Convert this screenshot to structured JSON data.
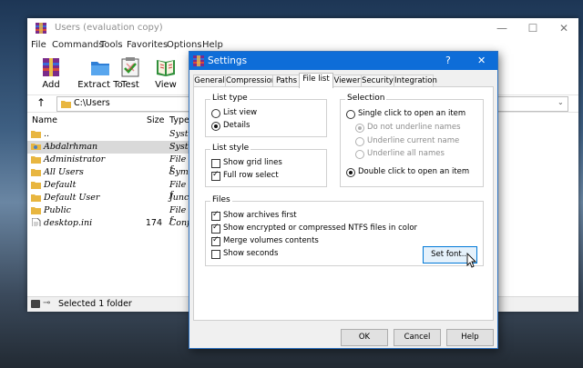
{
  "main_window": {
    "title": "Users (evaluation copy)",
    "menu": [
      "File",
      "Commands",
      "Tools",
      "Favorites",
      "Options",
      "Help"
    ],
    "toolbar": [
      {
        "label": "Add",
        "icon": "add-archive-icon"
      },
      {
        "label": "Extract To",
        "icon": "extract-folder-icon"
      },
      {
        "label": "Test",
        "icon": "test-clipboard-icon"
      },
      {
        "label": "View",
        "icon": "view-book-icon"
      }
    ],
    "path": "C:\\Users",
    "columns": {
      "name": "Name",
      "size": "Size",
      "type": "Type"
    },
    "files": [
      {
        "name": "..",
        "size": "",
        "type": "Syste"
      },
      {
        "name": "Abdalrhman",
        "size": "",
        "type": "Syste",
        "selected": true
      },
      {
        "name": "Administrator",
        "size": "",
        "type": "File f"
      },
      {
        "name": "All Users",
        "size": "",
        "type": "Symli"
      },
      {
        "name": "Default",
        "size": "",
        "type": "File f"
      },
      {
        "name": "Default User",
        "size": "",
        "type": "Junct"
      },
      {
        "name": "Public",
        "size": "",
        "type": "File f"
      },
      {
        "name": "desktop.ini",
        "size": "174",
        "type": "Confi"
      }
    ],
    "status": "Selected 1 folder"
  },
  "settings_dialog": {
    "title": "Settings",
    "help_glyph": "?",
    "close_glyph": "✕",
    "tabs": [
      "General",
      "Compression",
      "Paths",
      "File list",
      "Viewer",
      "Security",
      "Integration"
    ],
    "active_tab": "File list",
    "list_type": {
      "title": "List type",
      "options": [
        {
          "label": "List view",
          "selected": false
        },
        {
          "label": "Details",
          "selected": true
        }
      ]
    },
    "list_style": {
      "title": "List style",
      "options": [
        {
          "label": "Show grid lines",
          "checked": false
        },
        {
          "label": "Full row select",
          "checked": true
        }
      ]
    },
    "selection": {
      "title": "Selection",
      "single_click": {
        "label": "Single click to open an item",
        "selected": false
      },
      "underline_options": [
        {
          "label": "Do not underline names",
          "selected": true
        },
        {
          "label": "Underline current name",
          "selected": false
        },
        {
          "label": "Underline all names",
          "selected": false
        }
      ],
      "double_click": {
        "label": "Double click to open an item",
        "selected": true
      }
    },
    "files_group": {
      "title": "Files",
      "options": [
        {
          "label": "Show archives first",
          "checked": true
        },
        {
          "label": "Show encrypted or compressed NTFS files in color",
          "checked": true
        },
        {
          "label": "Merge volumes contents",
          "checked": true
        },
        {
          "label": "Show seconds",
          "checked": false
        }
      ],
      "set_font_label": "Set font..."
    },
    "buttons": {
      "ok": "OK",
      "cancel": "Cancel",
      "help": "Help"
    }
  }
}
